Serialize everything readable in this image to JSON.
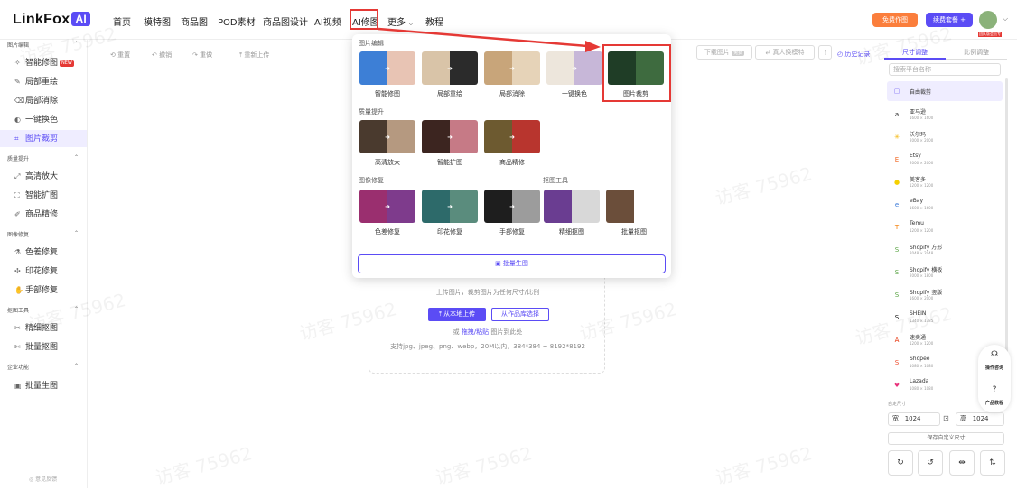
{
  "logo": {
    "text": "LinkFox",
    "badge": "AI"
  },
  "nav": [
    "首页",
    "模特图",
    "商品图",
    "POD素材",
    "商品图设计",
    "AI视频",
    "AI修图",
    "更多",
    "教程"
  ],
  "nav_more_chevron": "⌵",
  "header": {
    "free_btn": "免费作图",
    "pkg_btn": "续费套餐 +",
    "avatar_badge": "团队版会员专属"
  },
  "sidebar": {
    "sections": [
      {
        "title": "图片编辑",
        "items": [
          {
            "label": "智能修图",
            "icon": "magic-icon",
            "new": "NEW"
          },
          {
            "label": "局部重绘",
            "icon": "brush-icon"
          },
          {
            "label": "局部消除",
            "icon": "eraser-icon"
          },
          {
            "label": "一键换色",
            "icon": "palette-icon"
          },
          {
            "label": "图片裁剪",
            "icon": "crop-icon",
            "active": true
          }
        ]
      },
      {
        "title": "质量提升",
        "items": [
          {
            "label": "高清放大",
            "icon": "expand-icon"
          },
          {
            "label": "智能扩图",
            "icon": "extend-icon"
          },
          {
            "label": "商品精修",
            "icon": "refine-icon"
          }
        ]
      },
      {
        "title": "图像修复",
        "items": [
          {
            "label": "色差修复",
            "icon": "color-fix-icon"
          },
          {
            "label": "印花修复",
            "icon": "print-fix-icon"
          },
          {
            "label": "手部修复",
            "icon": "hand-icon"
          }
        ]
      },
      {
        "title": "抠图工具",
        "items": [
          {
            "label": "精细抠图",
            "icon": "cutout-icon"
          },
          {
            "label": "批量抠图",
            "icon": "batch-cutout-icon"
          }
        ]
      },
      {
        "title": "企业功能",
        "items": [
          {
            "label": "批量生图",
            "icon": "image-icon"
          }
        ]
      }
    ],
    "footer": "◎ 意见反馈"
  },
  "toolbar": {
    "reset": "⟲ 重置",
    "undo": "↶ 撤销",
    "redo": "↷ 重做",
    "reupload": "⤒ 重新上传",
    "download": "下载图片",
    "download_badge": "免费",
    "model": "真人换模特",
    "history": "◴ 历史记录"
  },
  "upload": {
    "hint": "上传图片，裁剪图片为任何尺寸/比例",
    "btn_local": "⤒ 从本地上传",
    "btn_lib": "从作品库选择",
    "drag_prefix": "或 ",
    "drag_link": "拖拽/粘贴",
    "drag_suffix": " 图片到此处",
    "formats": "支持jpg、jpeg、png、webp，20M以内，384*384 ~ 8192*8192"
  },
  "right_panel": {
    "tab_size": "尺寸调整",
    "tab_ratio": "比例调整",
    "search_placeholder": "搜索平台名称",
    "platforms": [
      {
        "name": "自由裁剪",
        "dim": "",
        "color": "#7c6cf5",
        "glyph": "▢"
      },
      {
        "name": "亚马逊",
        "dim": "1600 × 1600",
        "color": "#222222",
        "glyph": "a"
      },
      {
        "name": "沃尔玛",
        "dim": "2000 × 2000",
        "color": "#f4b400",
        "glyph": "✳"
      },
      {
        "name": "Etsy",
        "dim": "2000 × 2000",
        "color": "#f1641e",
        "glyph": "E"
      },
      {
        "name": "美客多",
        "dim": "1200 × 1200",
        "color": "#f5d000",
        "glyph": "●"
      },
      {
        "name": "eBay",
        "dim": "1600 × 1600",
        "color": "#3b7ad8",
        "glyph": "e"
      },
      {
        "name": "Temu",
        "dim": "1200 × 1200",
        "color": "#f57c00",
        "glyph": "T"
      },
      {
        "name": "Shopify 方形",
        "dim": "2048 × 2048",
        "color": "#5aa545",
        "glyph": "S"
      },
      {
        "name": "Shopify 横板",
        "dim": "2000 × 1800",
        "color": "#5aa545",
        "glyph": "S"
      },
      {
        "name": "Shopify 竖版",
        "dim": "1600 × 2000",
        "color": "#5aa545",
        "glyph": "S"
      },
      {
        "name": "SHEIN",
        "dim": "1340 × 1785",
        "color": "#111111",
        "glyph": "S"
      },
      {
        "name": "速卖通",
        "dim": "1200 × 1200",
        "color": "#e62e04",
        "glyph": "A"
      },
      {
        "name": "Shopee",
        "dim": "1080 × 1080",
        "color": "#ee4d2d",
        "glyph": "S"
      },
      {
        "name": "Lazada",
        "dim": "1080 × 1080",
        "color": "#e8317a",
        "glyph": "♥"
      }
    ],
    "custom_label": "自定尺寸",
    "width_label": "宽",
    "width_value": "1024",
    "height_label": "高",
    "height_value": "1024",
    "save_btn": "保存自定义尺寸"
  },
  "float_help": {
    "ops": "操作咨询",
    "tutorial": "产品教程"
  },
  "dropdown": {
    "sec_edit": "图片编辑",
    "sec_quality": "质量提升",
    "sec_repair": "图像修复",
    "sec_cutout": "抠图工具",
    "edit": [
      "智能修图",
      "局部重绘",
      "局部消除",
      "一键换色",
      "图片裁剪"
    ],
    "quality": [
      "高清放大",
      "智能扩图",
      "商品精修"
    ],
    "repair": [
      "色差修复",
      "印花修复",
      "手部修复"
    ],
    "cutout": [
      "精细抠图",
      "批量抠图"
    ],
    "batch": "▣ 批量生图"
  },
  "watermark": "访客 75962"
}
